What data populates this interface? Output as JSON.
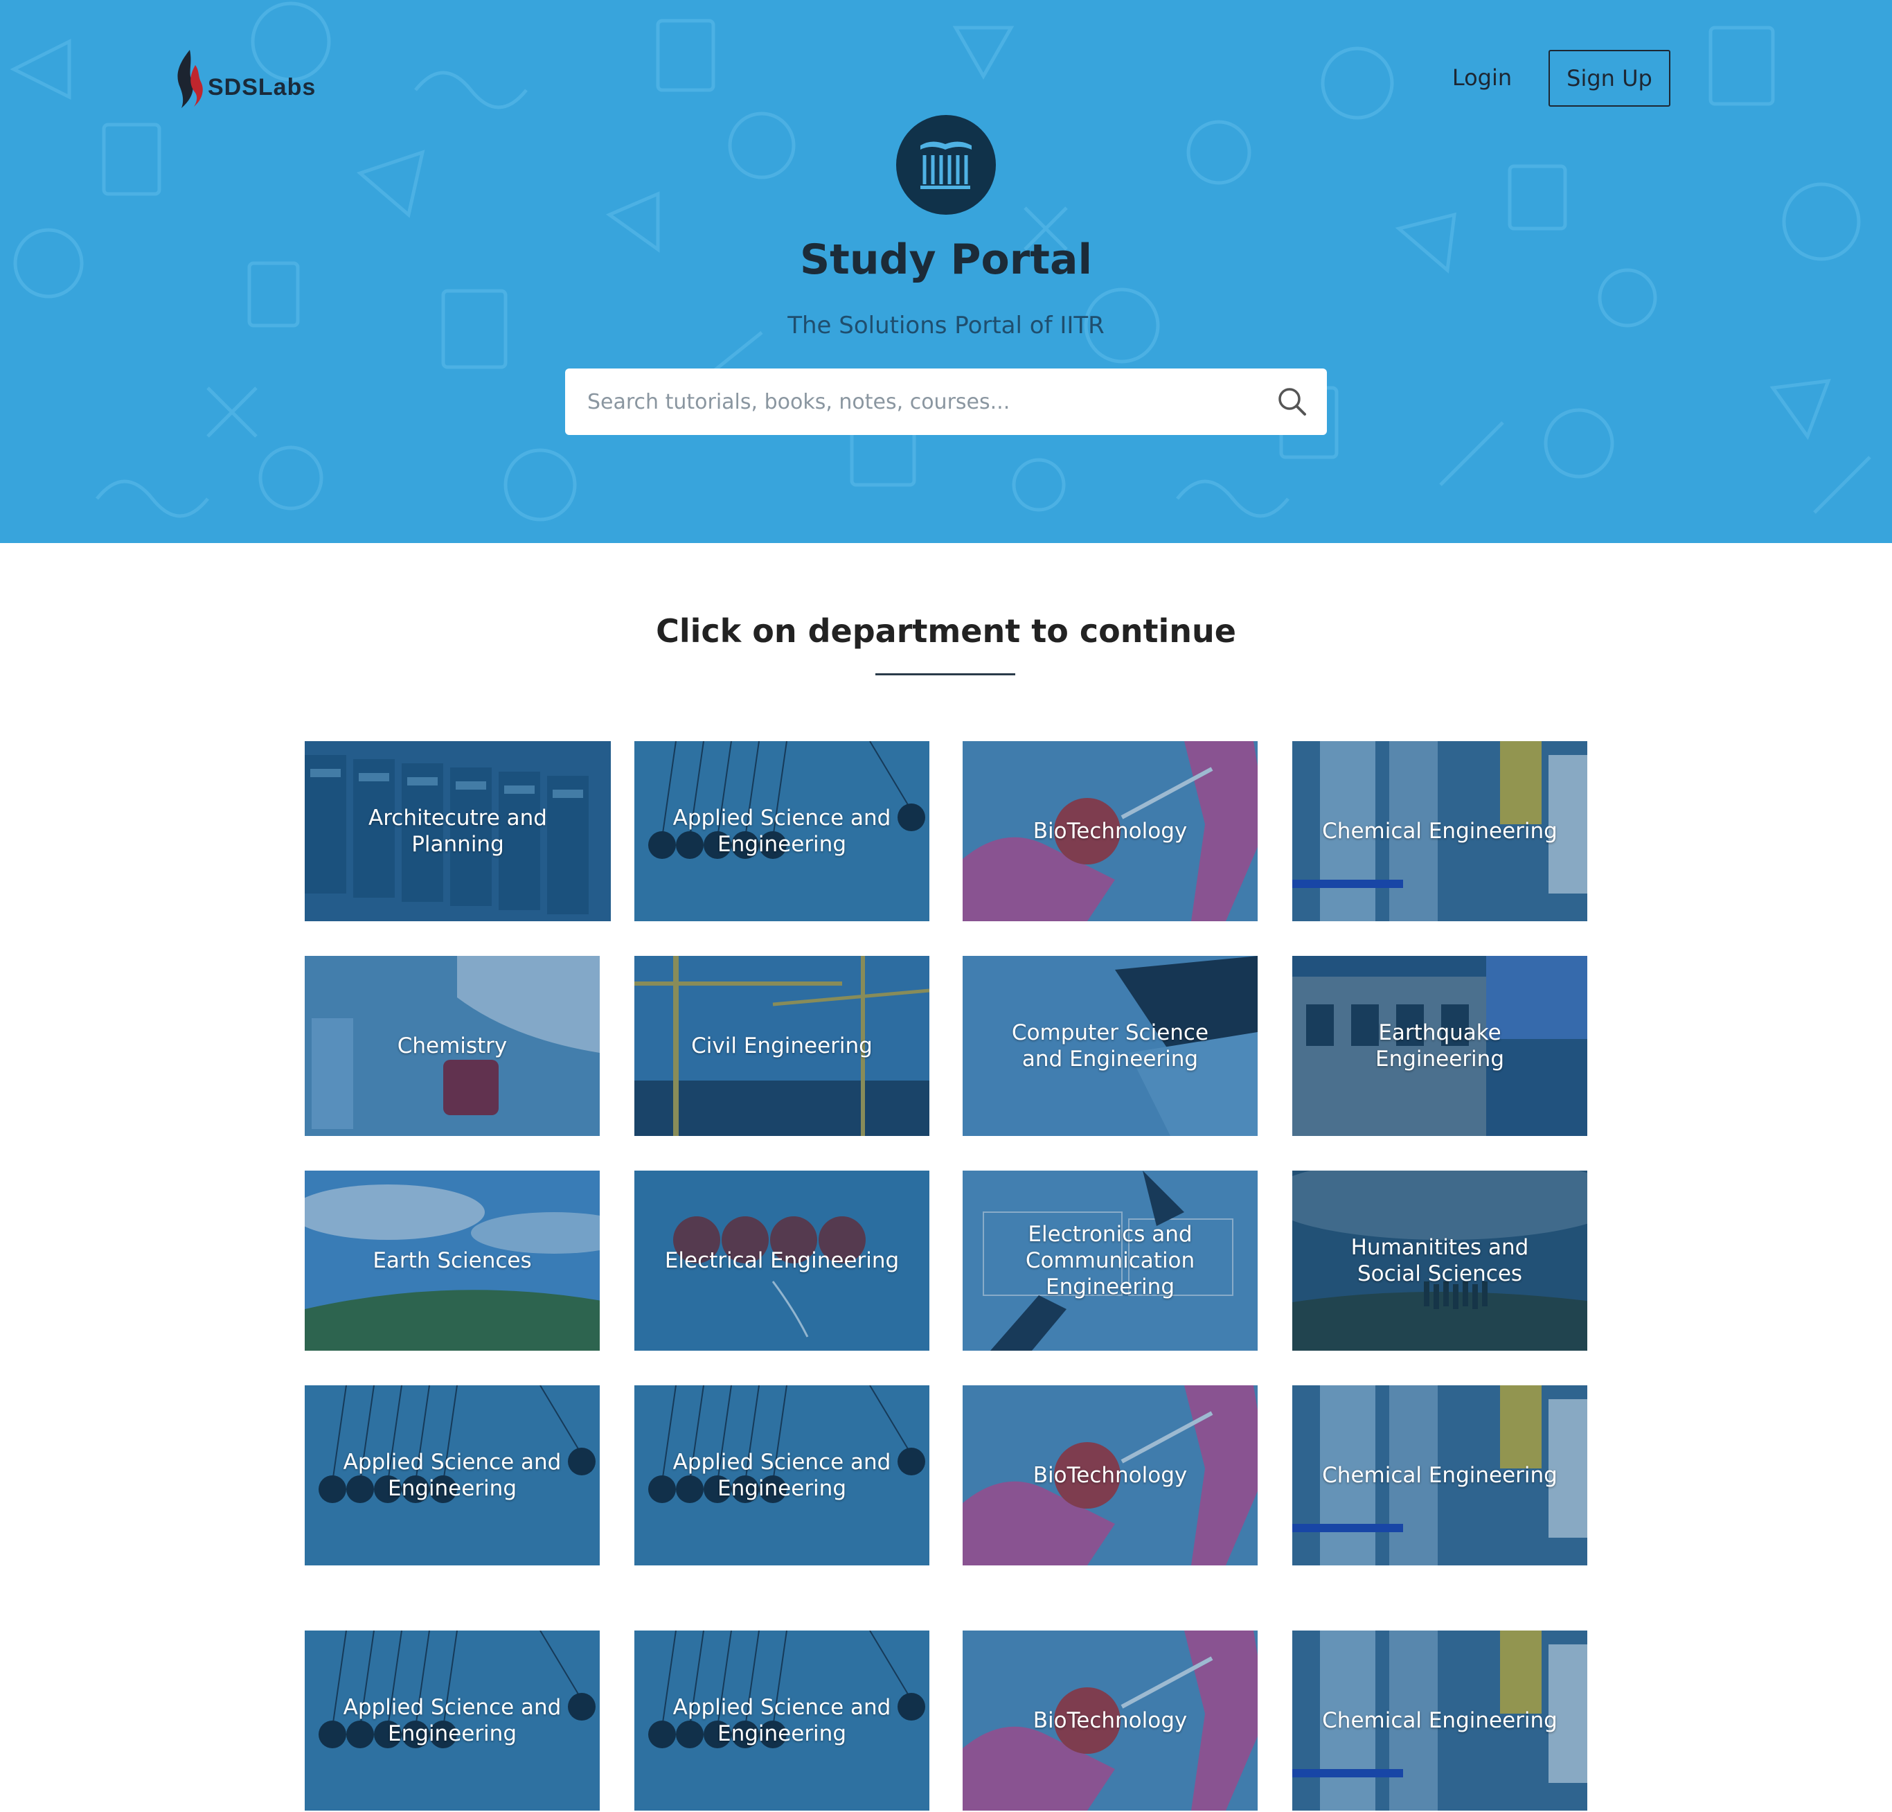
{
  "header": {
    "logo_text": "SDSLabs",
    "login_label": "Login",
    "signup_label": "Sign Up"
  },
  "hero": {
    "badge_icon": "library-icon",
    "title": "Study Portal",
    "subtitle": "The Solutions Portal of IITR",
    "search_placeholder": "Search tutorials, books, notes, courses...",
    "search_icon": "search-icon"
  },
  "main": {
    "heading": "Click on department to continue"
  },
  "departments": [
    {
      "label": "Architecutre and Planning",
      "theme": "library"
    },
    {
      "label": "Applied Science and Engineering",
      "theme": "pendulum"
    },
    {
      "label": "BioTechnology",
      "theme": "tomato"
    },
    {
      "label": "Chemical Engineering",
      "theme": "tubes"
    },
    {
      "label": "Chemistry",
      "theme": "beaker"
    },
    {
      "label": "Civil Engineering",
      "theme": "cranes"
    },
    {
      "label": "Computer Science and Engineering",
      "theme": "laptop"
    },
    {
      "label": "Earthquake Engineering",
      "theme": "ruins"
    },
    {
      "label": "Earth Sciences",
      "theme": "field"
    },
    {
      "label": "Electrical Engineering",
      "theme": "bulbs"
    },
    {
      "label": "Electronics and Communication Engineering",
      "theme": "desk"
    },
    {
      "label": "Humanitites and Social Sciences",
      "theme": "people"
    },
    {
      "label": "Applied Science and Engineering",
      "theme": "pendulum"
    },
    {
      "label": "Applied Science and Engineering",
      "theme": "pendulum"
    },
    {
      "label": "BioTechnology",
      "theme": "tomato"
    },
    {
      "label": "Chemical Engineering",
      "theme": "tubes"
    },
    {
      "label": "Applied Science and Engineering",
      "theme": "pendulum"
    },
    {
      "label": "Applied Science and Engineering",
      "theme": "pendulum"
    },
    {
      "label": "BioTechnology",
      "theme": "tomato"
    },
    {
      "label": "Chemical Engineering",
      "theme": "tubes"
    }
  ],
  "colors": {
    "hero_bg": "#38a4dc",
    "badge_bg": "#10324a",
    "text_dark": "#1c2b38"
  }
}
